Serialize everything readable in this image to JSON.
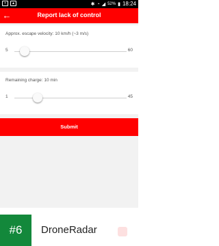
{
  "statusbar": {
    "battery_pct": "52%",
    "time": "18:24",
    "left_icons": [
      "sim-icon",
      "notification-icon"
    ],
    "right_icons": [
      "bluetooth-icon",
      "wifi-icon",
      "signal-icon",
      "battery-icon"
    ]
  },
  "appbar": {
    "title": "Report lack of control",
    "back_icon": "arrow-back-icon",
    "color": "#ff0000"
  },
  "sliders": [
    {
      "label": "Approx. escape velocity: 10 km/h (~3 m/s)",
      "min": "5",
      "max": "60",
      "value": 10
    },
    {
      "label": "Remaining charge: 10 min",
      "min": "1",
      "max": "45",
      "value": 10
    }
  ],
  "submit_label": "Submit",
  "banner": {
    "badge": "#6",
    "app_name": "DroneRadar",
    "badge_color": "#13883b"
  }
}
